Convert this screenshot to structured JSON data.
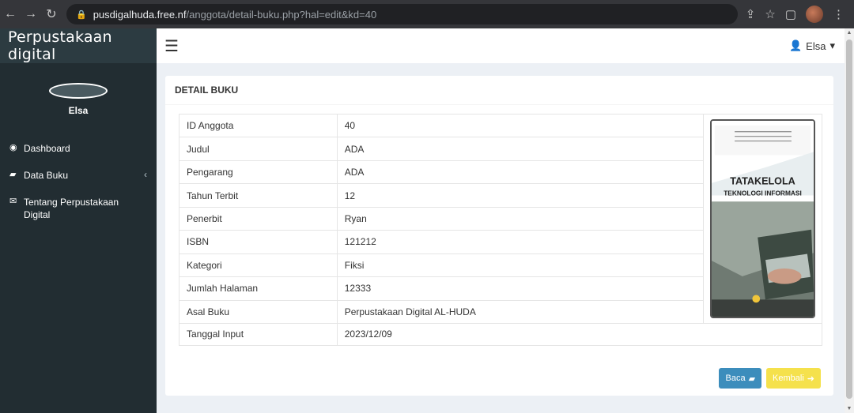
{
  "browser": {
    "url_host": "pusdigalhuda.free.nf",
    "url_path": "/anggota/detail-buku.php?hal=edit&kd=40"
  },
  "sidebar": {
    "brand": "Perpustakaan digital",
    "user_name": "Elsa",
    "items": [
      {
        "label": "Dashboard",
        "icon": "dashboard-icon"
      },
      {
        "label": "Data Buku",
        "icon": "book-icon"
      },
      {
        "label": "Tentang Perpustakaan Digital",
        "icon": "envelope-icon"
      }
    ]
  },
  "navbar": {
    "user_label": "Elsa"
  },
  "box": {
    "title": "DETAIL BUKU",
    "rows": [
      {
        "key": "ID Anggota",
        "value": "40"
      },
      {
        "key": "Judul",
        "value": "ADA"
      },
      {
        "key": "Pengarang",
        "value": "ADA"
      },
      {
        "key": "Tahun Terbit",
        "value": "12"
      },
      {
        "key": "Penerbit",
        "value": "Ryan"
      },
      {
        "key": "ISBN",
        "value": "121212"
      },
      {
        "key": "Kategori",
        "value": "Fiksi"
      },
      {
        "key": "Jumlah Halaman",
        "value": "12333"
      },
      {
        "key": "Asal Buku",
        "value": "Perpustakaan Digital AL-HUDA"
      },
      {
        "key": "Tanggal Input",
        "value": "2023/12/09"
      }
    ],
    "cover": {
      "title_line1": "TATAKELOLA",
      "title_line2": "TEKNOLOGI INFORMASI"
    },
    "buttons": {
      "baca": "Baca",
      "kembali": "Kembali"
    }
  },
  "colors": {
    "sidebar_bg": "#222d32",
    "brand_bg": "#2c3b41",
    "primary": "#3c8dbc",
    "warning": "#f5e14c",
    "content_bg": "#ecf0f5"
  }
}
